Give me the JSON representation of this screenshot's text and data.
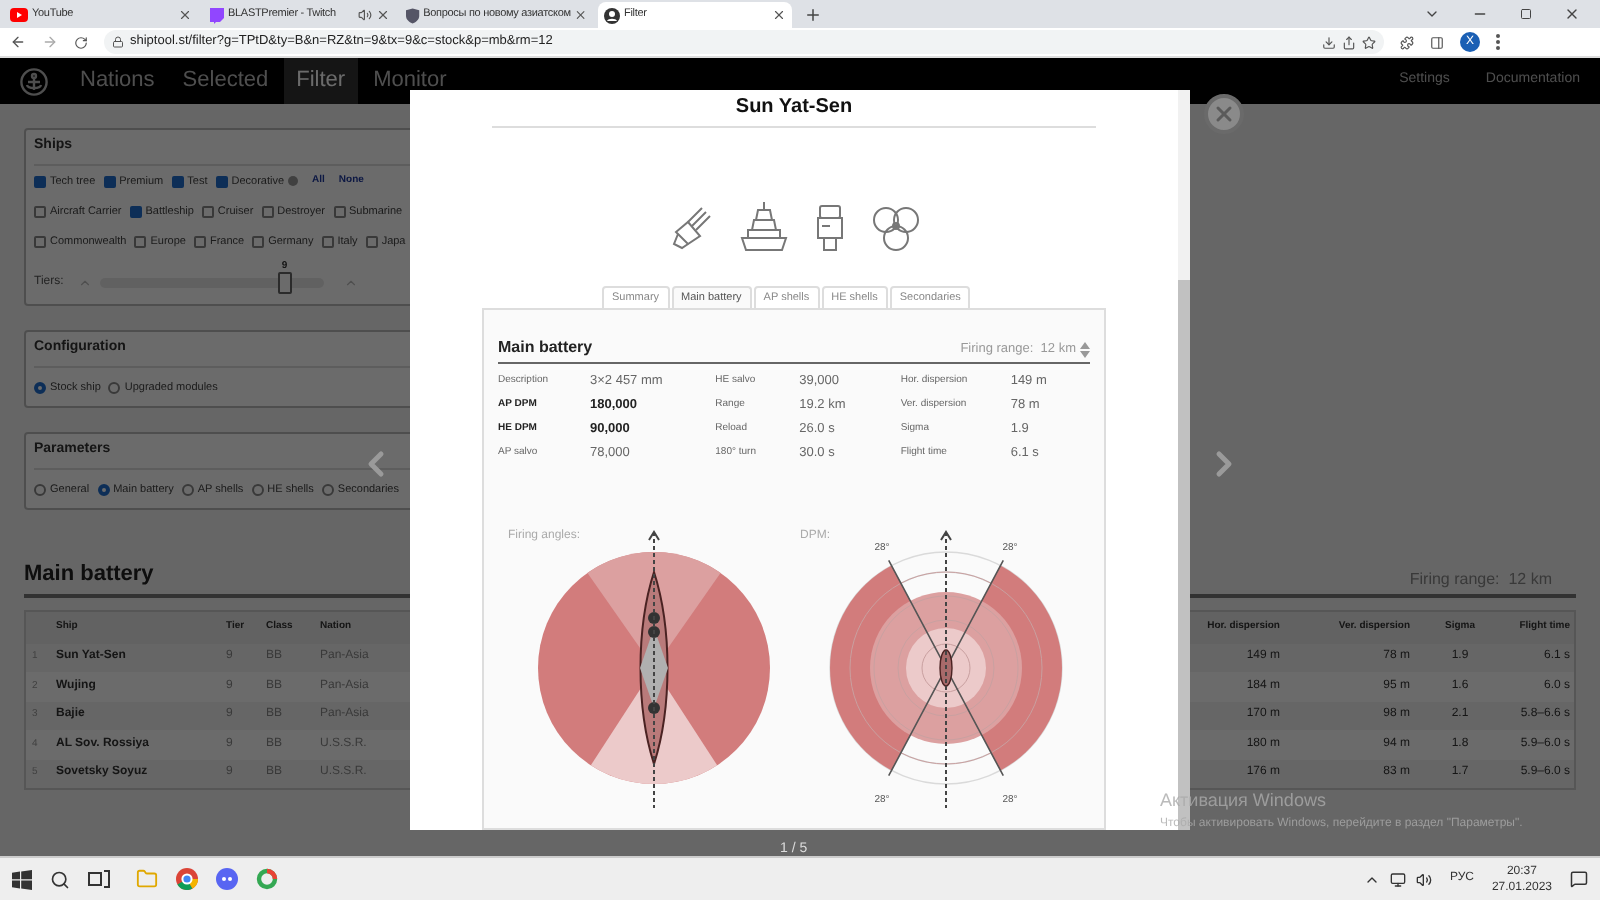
{
  "browser": {
    "tabs": [
      {
        "title": "YouTube",
        "kind": "video",
        "selected": false,
        "audio": false
      },
      {
        "title": "BLASTPremier - Twitch",
        "kind": "stream",
        "selected": false,
        "audio": true
      },
      {
        "title": "Вопросы по новому азиатском",
        "kind": "forum",
        "selected": false,
        "audio": false
      },
      {
        "title": "Filter",
        "kind": "site",
        "selected": true,
        "audio": false
      }
    ],
    "url": "shiptool.st/filter?g=TPtD&ty=B&n=RZ&tn=9&tx=9&c=stock&p=mb&rm=12",
    "profile_initial": "X"
  },
  "nav": {
    "items": [
      {
        "label": "Nations",
        "selected": false
      },
      {
        "label": "Selected",
        "selected": false
      },
      {
        "label": "Filter",
        "selected": true
      },
      {
        "label": "Monitor",
        "selected": false
      }
    ],
    "right": [
      "Settings",
      "Documentation"
    ]
  },
  "ships_panel": {
    "title": "Ships",
    "types": [
      {
        "label": "Tech tree",
        "checked": true
      },
      {
        "label": "Premium",
        "checked": true
      },
      {
        "label": "Test",
        "checked": true
      },
      {
        "label": "Decorative",
        "checked": true
      }
    ],
    "links": [
      "All",
      "None"
    ],
    "classes": [
      {
        "label": "Aircraft Carrier",
        "checked": false
      },
      {
        "label": "Battleship",
        "checked": true
      },
      {
        "label": "Cruiser",
        "checked": false
      },
      {
        "label": "Destroyer",
        "checked": false
      },
      {
        "label": "Submarine",
        "checked": false
      }
    ],
    "nations": [
      {
        "label": "Commonwealth",
        "checked": false
      },
      {
        "label": "Europe",
        "checked": false
      },
      {
        "label": "France",
        "checked": false
      },
      {
        "label": "Germany",
        "checked": false
      },
      {
        "label": "Italy",
        "checked": false
      },
      {
        "label": "Japa",
        "checked": false
      }
    ],
    "tiers": {
      "label": "Tiers:",
      "value": "9",
      "level": 0.82
    }
  },
  "configuration": {
    "title": "Configuration",
    "options": [
      {
        "label": "Stock ship",
        "selected": true
      },
      {
        "label": "Upgraded modules",
        "selected": false
      }
    ]
  },
  "parameters": {
    "title": "Parameters",
    "options": [
      {
        "label": "General",
        "selected": false
      },
      {
        "label": "Main battery",
        "selected": true
      },
      {
        "label": "AP shells",
        "selected": false
      },
      {
        "label": "HE shells",
        "selected": false
      },
      {
        "label": "Secondaries",
        "selected": false
      }
    ]
  },
  "results": {
    "title": "Main battery",
    "firing_range": "Firing range:  12 km",
    "left_columns": [
      "Ship",
      "Tier",
      "Class",
      "Nation"
    ],
    "right_columns": [
      "Hor. dispersion",
      "Ver. dispersion",
      "Sigma",
      "Flight time"
    ],
    "rows": [
      {
        "index": "1",
        "ship": "Sun Yat-Sen",
        "tier": "9",
        "class": "BB",
        "nation": "Pan-Asia",
        "hor": "149 m",
        "ver": "78 m",
        "sigma": "1.9",
        "flight": "6.1 s"
      },
      {
        "index": "2",
        "ship": "Wujing",
        "tier": "9",
        "class": "BB",
        "nation": "Pan-Asia",
        "hor": "184 m",
        "ver": "95 m",
        "sigma": "1.6",
        "flight": "6.0 s"
      },
      {
        "index": "3",
        "ship": "Bajie",
        "tier": "9",
        "class": "BB",
        "nation": "Pan-Asia",
        "hor": "170 m",
        "ver": "98 m",
        "sigma": "2.1",
        "flight": "5.8–6.6 s"
      },
      {
        "index": "4",
        "ship": "AL Sov. Rossiya",
        "tier": "9",
        "class": "BB",
        "nation": "U.S.S.R.",
        "hor": "180 m",
        "ver": "94 m",
        "sigma": "1.8",
        "flight": "5.9–6.0 s"
      },
      {
        "index": "5",
        "ship": "Sovetsky Soyuz",
        "tier": "9",
        "class": "BB",
        "nation": "U.S.S.R.",
        "hor": "176 m",
        "ver": "83 m",
        "sigma": "1.7",
        "flight": "5.9–6.0 s"
      }
    ]
  },
  "modal": {
    "title": "Sun Yat-Sen",
    "modules": [
      {
        "kind": "gun"
      },
      {
        "kind": "hull"
      },
      {
        "kind": "engine"
      },
      {
        "kind": "propeller"
      }
    ],
    "tabs": [
      {
        "label": "Summary",
        "selected": false
      },
      {
        "label": "Main battery",
        "selected": true
      },
      {
        "label": "AP shells",
        "selected": false
      },
      {
        "label": "HE shells",
        "selected": false
      },
      {
        "label": "Secondaries",
        "selected": false
      }
    ],
    "section_title": "Main battery",
    "firing_range": "Firing range:  12 km",
    "stat_columns": [
      [
        {
          "label": "Description",
          "value": "3×2 457 mm",
          "emphasized": false
        },
        {
          "label": "AP DPM",
          "value": "180,000",
          "emphasized": true
        },
        {
          "label": "HE DPM",
          "value": "90,000",
          "emphasized": true
        },
        {
          "label": "AP salvo",
          "value": "78,000",
          "emphasized": false
        }
      ],
      [
        {
          "label": "HE salvo",
          "value": "39,000",
          "emphasized": false
        },
        {
          "label": "Range",
          "value": "19.2 km",
          "emphasized": false
        },
        {
          "label": "Reload",
          "value": "26.0 s",
          "emphasized": false
        },
        {
          "label": "180° turn",
          "value": "30.0 s",
          "emphasized": false
        }
      ],
      [
        {
          "label": "Hor. dispersion",
          "value": "149 m",
          "emphasized": false
        },
        {
          "label": "Ver. dispersion",
          "value": "78 m",
          "emphasized": false
        },
        {
          "label": "Sigma",
          "value": "1.9",
          "emphasized": false
        },
        {
          "label": "Flight time",
          "value": "6.1 s",
          "emphasized": false
        }
      ]
    ],
    "firing_angles_label": "Firing angles:",
    "dpm_label": "DPM:",
    "angle_labels": [
      "28°",
      "28°",
      "28°",
      "28°"
    ]
  },
  "pager": "1 / 5",
  "os_notice": {
    "title": "Активация Windows",
    "text": "Чтобы активировать Windows, перейдите в раздел \"Параметры\"."
  },
  "taskbar": {
    "language": "РУС",
    "time": "20:37",
    "date": "27.01.2023"
  }
}
